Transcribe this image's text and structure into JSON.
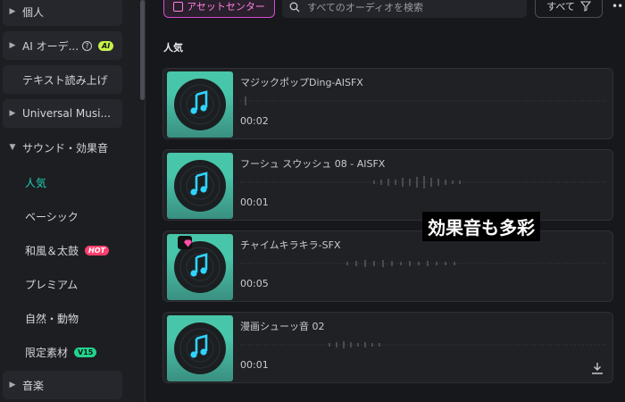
{
  "sidebar": {
    "item_kojin": "個人",
    "item_ai": "AI オーデ...",
    "item_ai_badge": "AI",
    "item_tts": "テキスト読み上げ",
    "item_universal": "Universal Musi...",
    "item_sound": "サウンド・効果音",
    "sub_popular": "人気",
    "sub_basic": "ベーシック",
    "sub_wafu": "和風＆太鼓",
    "sub_wafu_badge": "HOT",
    "sub_premium": "プレミアム",
    "sub_nature": "自然・動物",
    "sub_limited": "限定素材",
    "sub_limited_badge": "V15",
    "item_music": "音楽"
  },
  "topbar": {
    "asset_center": "アセットセンター",
    "search_placeholder": "すべてのオーディオを検索",
    "filter_label": "すべて"
  },
  "section_title": "人気",
  "tracks": [
    {
      "title": "マジックポップDing-AISFX",
      "duration": "00:02"
    },
    {
      "title": "フーシュ スウッシュ 08 - AISFX",
      "duration": "00:01"
    },
    {
      "title": "チャイムキラキラ-SFX",
      "duration": "00:05"
    },
    {
      "title": "漫画シューッ音 02",
      "duration": "00:01"
    }
  ],
  "overlay_caption": "効果音も多彩",
  "colors": {
    "accent": "#1fd3b7",
    "asset_pink": "#ff7fe2",
    "thumb": "#48c6a9"
  }
}
